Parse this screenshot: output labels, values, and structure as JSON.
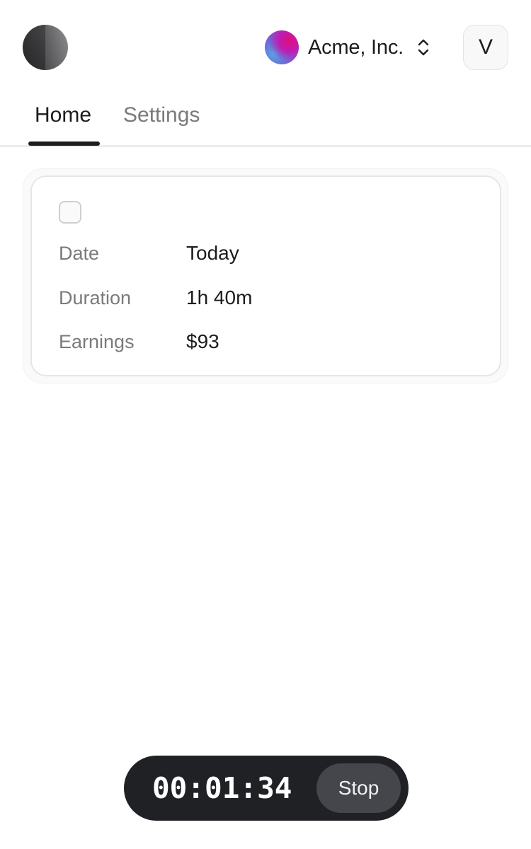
{
  "header": {
    "org_name": "Acme, Inc.",
    "user_initial": "V",
    "icons": {
      "app_logo": "app-logo-icon",
      "org_avatar": "org-avatar-icon",
      "org_switch": "chevron-up-down-icon"
    }
  },
  "tabs": [
    {
      "label": "Home",
      "active": true
    },
    {
      "label": "Settings",
      "active": false
    }
  ],
  "session_card": {
    "checked": false,
    "rows": [
      {
        "label": "Date",
        "value": "Today"
      },
      {
        "label": "Duration",
        "value": "1h 40m"
      },
      {
        "label": "Earnings",
        "value": "$93"
      }
    ]
  },
  "timer": {
    "elapsed": "00:01:34",
    "stop_label": "Stop"
  },
  "colors": {
    "text_primary": "#1c1c1e",
    "text_secondary": "#7a7a7a",
    "timer_bg": "#1f2124",
    "stop_bg": "#44464b"
  }
}
